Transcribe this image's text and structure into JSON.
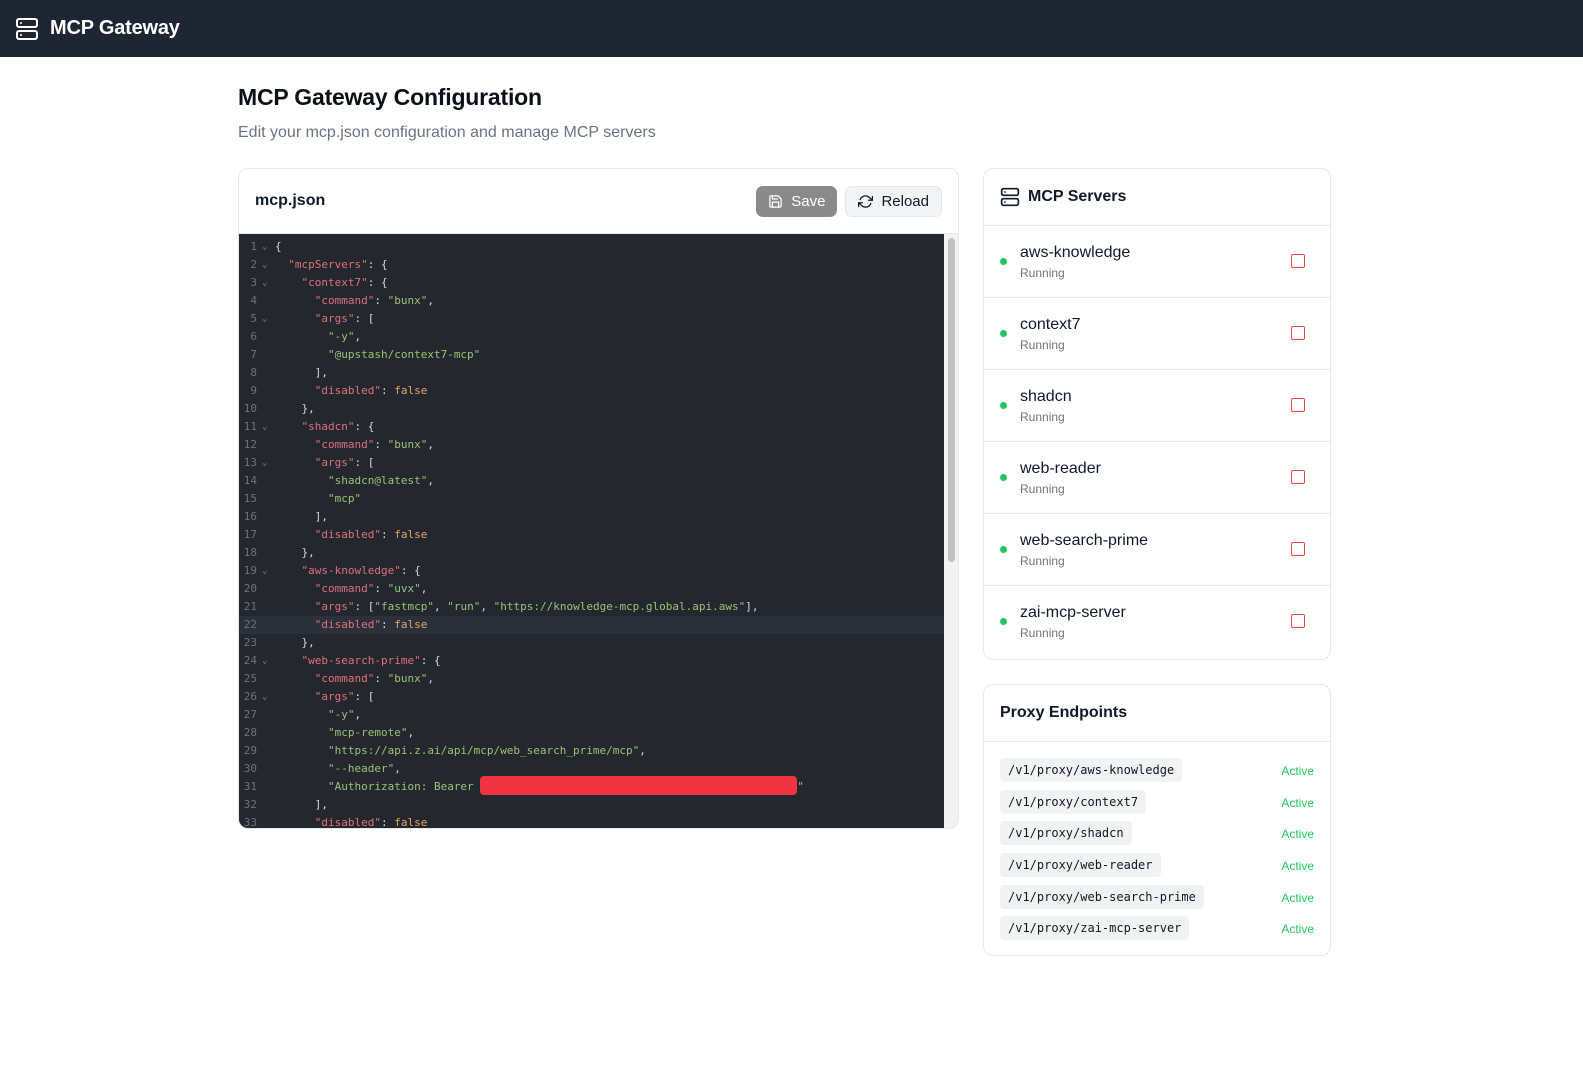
{
  "app": {
    "title": "MCP Gateway",
    "icon": "server-icon"
  },
  "page": {
    "title": "MCP Gateway Configuration",
    "subtitle": "Edit your mcp.json configuration and manage MCP servers"
  },
  "editor": {
    "filename": "mcp.json",
    "save_label": "Save",
    "reload_label": "Reload",
    "highlighted_line": 22,
    "lines": [
      {
        "n": "1",
        "fold": true,
        "tokens": [
          [
            "p",
            "{"
          ]
        ]
      },
      {
        "n": "2",
        "fold": true,
        "tokens": [
          [
            "p",
            "  "
          ],
          [
            "k",
            "\"mcpServers\""
          ],
          [
            "p",
            ": {"
          ]
        ]
      },
      {
        "n": "3",
        "fold": true,
        "tokens": [
          [
            "p",
            "    "
          ],
          [
            "k",
            "\"context7\""
          ],
          [
            "p",
            ": {"
          ]
        ]
      },
      {
        "n": "4",
        "fold": false,
        "tokens": [
          [
            "p",
            "      "
          ],
          [
            "k",
            "\"command\""
          ],
          [
            "p",
            ": "
          ],
          [
            "s",
            "\"bunx\""
          ],
          [
            "p",
            ","
          ]
        ]
      },
      {
        "n": "5",
        "fold": true,
        "tokens": [
          [
            "p",
            "      "
          ],
          [
            "k",
            "\"args\""
          ],
          [
            "p",
            ": ["
          ]
        ]
      },
      {
        "n": "6",
        "fold": false,
        "tokens": [
          [
            "p",
            "        "
          ],
          [
            "s",
            "\"-y\""
          ],
          [
            "p",
            ","
          ]
        ]
      },
      {
        "n": "7",
        "fold": false,
        "tokens": [
          [
            "p",
            "        "
          ],
          [
            "s",
            "\"@upstash/context7-mcp\""
          ]
        ]
      },
      {
        "n": "8",
        "fold": false,
        "tokens": [
          [
            "p",
            "      ],"
          ]
        ]
      },
      {
        "n": "9",
        "fold": false,
        "tokens": [
          [
            "p",
            "      "
          ],
          [
            "k",
            "\"disabled\""
          ],
          [
            "p",
            ": "
          ],
          [
            "b",
            "false"
          ]
        ]
      },
      {
        "n": "10",
        "fold": false,
        "tokens": [
          [
            "p",
            "    },"
          ]
        ]
      },
      {
        "n": "11",
        "fold": true,
        "tokens": [
          [
            "p",
            "    "
          ],
          [
            "k",
            "\"shadcn\""
          ],
          [
            "p",
            ": {"
          ]
        ]
      },
      {
        "n": "12",
        "fold": false,
        "tokens": [
          [
            "p",
            "      "
          ],
          [
            "k",
            "\"command\""
          ],
          [
            "p",
            ": "
          ],
          [
            "s",
            "\"bunx\""
          ],
          [
            "p",
            ","
          ]
        ]
      },
      {
        "n": "13",
        "fold": true,
        "tokens": [
          [
            "p",
            "      "
          ],
          [
            "k",
            "\"args\""
          ],
          [
            "p",
            ": ["
          ]
        ]
      },
      {
        "n": "14",
        "fold": false,
        "tokens": [
          [
            "p",
            "        "
          ],
          [
            "s",
            "\"shadcn@latest\""
          ],
          [
            "p",
            ","
          ]
        ]
      },
      {
        "n": "15",
        "fold": false,
        "tokens": [
          [
            "p",
            "        "
          ],
          [
            "s",
            "\"mcp\""
          ]
        ]
      },
      {
        "n": "16",
        "fold": false,
        "tokens": [
          [
            "p",
            "      ],"
          ]
        ]
      },
      {
        "n": "17",
        "fold": false,
        "tokens": [
          [
            "p",
            "      "
          ],
          [
            "k",
            "\"disabled\""
          ],
          [
            "p",
            ": "
          ],
          [
            "b",
            "false"
          ]
        ]
      },
      {
        "n": "18",
        "fold": false,
        "tokens": [
          [
            "p",
            "    },"
          ]
        ]
      },
      {
        "n": "19",
        "fold": true,
        "tokens": [
          [
            "p",
            "    "
          ],
          [
            "k",
            "\"aws-knowledge\""
          ],
          [
            "p",
            ": {"
          ]
        ]
      },
      {
        "n": "20",
        "fold": false,
        "tokens": [
          [
            "p",
            "      "
          ],
          [
            "k",
            "\"command\""
          ],
          [
            "p",
            ": "
          ],
          [
            "s",
            "\"uvx\""
          ],
          [
            "p",
            ","
          ]
        ]
      },
      {
        "n": "21",
        "fold": false,
        "tokens": [
          [
            "p",
            "      "
          ],
          [
            "k",
            "\"args\""
          ],
          [
            "p",
            ": ["
          ],
          [
            "s",
            "\"fastmcp\""
          ],
          [
            "p",
            ", "
          ],
          [
            "s",
            "\"run\""
          ],
          [
            "p",
            ", "
          ],
          [
            "s",
            "\"https://knowledge-mcp.global.api.aws\""
          ],
          [
            "p",
            "],"
          ]
        ]
      },
      {
        "n": "22",
        "fold": false,
        "tokens": [
          [
            "p",
            "      "
          ],
          [
            "k",
            "\"disabled\""
          ],
          [
            "p",
            ": "
          ],
          [
            "b",
            "false"
          ]
        ]
      },
      {
        "n": "23",
        "fold": false,
        "tokens": [
          [
            "p",
            "    },"
          ]
        ]
      },
      {
        "n": "24",
        "fold": true,
        "tokens": [
          [
            "p",
            "    "
          ],
          [
            "k",
            "\"web-search-prime\""
          ],
          [
            "p",
            ": {"
          ]
        ]
      },
      {
        "n": "25",
        "fold": false,
        "tokens": [
          [
            "p",
            "      "
          ],
          [
            "k",
            "\"command\""
          ],
          [
            "p",
            ": "
          ],
          [
            "s",
            "\"bunx\""
          ],
          [
            "p",
            ","
          ]
        ]
      },
      {
        "n": "26",
        "fold": true,
        "tokens": [
          [
            "p",
            "      "
          ],
          [
            "k",
            "\"args\""
          ],
          [
            "p",
            ": ["
          ]
        ]
      },
      {
        "n": "27",
        "fold": false,
        "tokens": [
          [
            "p",
            "        "
          ],
          [
            "s",
            "\"-y\""
          ],
          [
            "p",
            ","
          ]
        ]
      },
      {
        "n": "28",
        "fold": false,
        "tokens": [
          [
            "p",
            "        "
          ],
          [
            "s",
            "\"mcp-remote\""
          ],
          [
            "p",
            ","
          ]
        ]
      },
      {
        "n": "29",
        "fold": false,
        "tokens": [
          [
            "p",
            "        "
          ],
          [
            "s",
            "\"https://api.z.ai/api/mcp/web_search_prime/mcp\""
          ],
          [
            "p",
            ","
          ]
        ]
      },
      {
        "n": "30",
        "fold": false,
        "tokens": [
          [
            "p",
            "        "
          ],
          [
            "s",
            "\"--header\""
          ],
          [
            "p",
            ","
          ]
        ]
      },
      {
        "n": "31",
        "fold": false,
        "tokens": [
          [
            "p",
            "        "
          ],
          [
            "s",
            "\"Authorization: Bearer "
          ],
          [
            "r",
            ""
          ],
          [
            "s",
            "\""
          ]
        ]
      },
      {
        "n": "32",
        "fold": false,
        "tokens": [
          [
            "p",
            "      ],"
          ]
        ]
      },
      {
        "n": "33",
        "fold": false,
        "tokens": [
          [
            "p",
            "      "
          ],
          [
            "k",
            "\"disabled\""
          ],
          [
            "p",
            ": "
          ],
          [
            "b",
            "false"
          ]
        ]
      }
    ]
  },
  "servers": {
    "title": "MCP Servers",
    "items": [
      {
        "name": "aws-knowledge",
        "status": "Running"
      },
      {
        "name": "context7",
        "status": "Running"
      },
      {
        "name": "shadcn",
        "status": "Running"
      },
      {
        "name": "web-reader",
        "status": "Running"
      },
      {
        "name": "web-search-prime",
        "status": "Running"
      },
      {
        "name": "zai-mcp-server",
        "status": "Running"
      }
    ]
  },
  "proxy": {
    "title": "Proxy Endpoints",
    "items": [
      {
        "path": "/v1/proxy/aws-knowledge",
        "status": "Active"
      },
      {
        "path": "/v1/proxy/context7",
        "status": "Active"
      },
      {
        "path": "/v1/proxy/shadcn",
        "status": "Active"
      },
      {
        "path": "/v1/proxy/web-reader",
        "status": "Active"
      },
      {
        "path": "/v1/proxy/web-search-prime",
        "status": "Active"
      },
      {
        "path": "/v1/proxy/zai-mcp-server",
        "status": "Active"
      }
    ]
  },
  "colors": {
    "topbar": "#1e2533",
    "code_bg": "#24272e",
    "status_green": "#22c55e",
    "stop_red": "#ef4444",
    "redaction": "#ef3340"
  }
}
